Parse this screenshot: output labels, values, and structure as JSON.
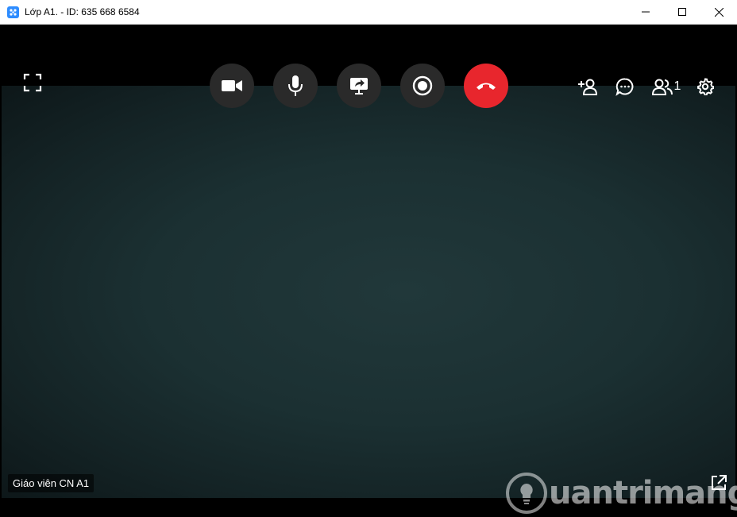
{
  "window": {
    "title": "Lớp A1. - ID: 635 668 6584"
  },
  "toolbar": {
    "camera_icon": "video-camera-icon",
    "mic_icon": "microphone-icon",
    "share_icon": "screen-share-icon",
    "record_icon": "record-icon",
    "hangup_icon": "phone-hangup-icon",
    "hangup_color": "#e8262d"
  },
  "tools": {
    "add_user_icon": "add-user-icon",
    "chat_icon": "chat-icon",
    "participants_icon": "participants-icon",
    "participants_count": "1",
    "settings_icon": "gear-icon"
  },
  "video": {
    "participant_name": "Giáo viên CN A1"
  },
  "watermark": {
    "text": "uantrimang"
  }
}
